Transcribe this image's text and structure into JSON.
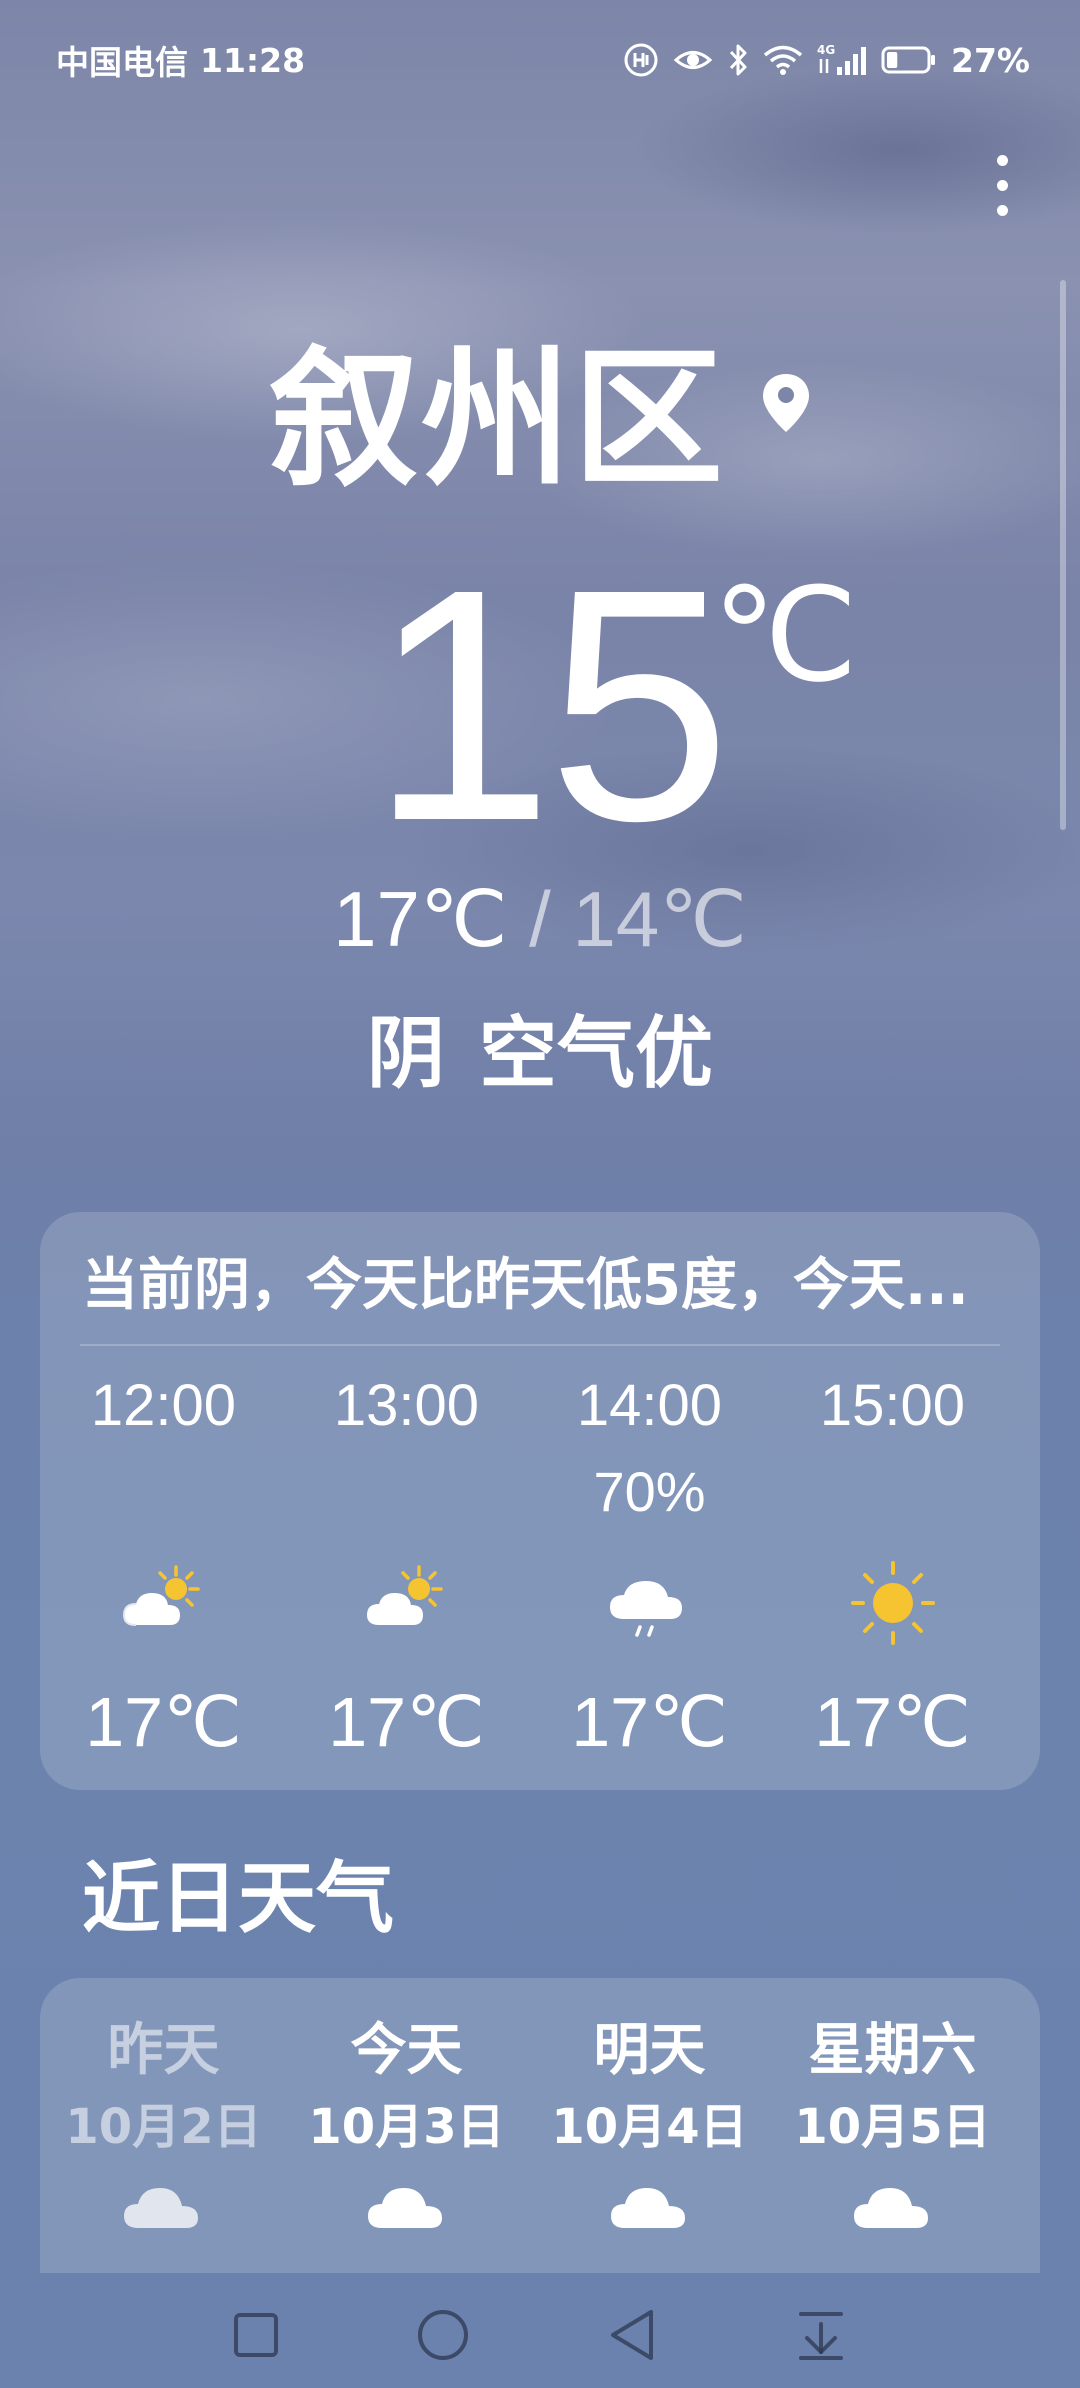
{
  "status_bar": {
    "carrier": "中国电信",
    "time": "11:28",
    "network": "4G",
    "battery_percent": "27%",
    "battery_level": 0.27,
    "icons": [
      "hd-icon",
      "eye-icon",
      "bluetooth-icon",
      "wifi-icon",
      "signal-icon",
      "battery-icon"
    ]
  },
  "location": {
    "name": "叙州区",
    "icon": "location-pin-icon"
  },
  "current": {
    "temp": "15",
    "unit": "℃",
    "high": "17℃",
    "separator": "/",
    "low": "14℃",
    "condition": "阴",
    "air_quality": "空气优"
  },
  "hourly": {
    "summary": "当前阴，今天比昨天低5度，今天...",
    "items": [
      {
        "time": "12:00",
        "precip": "",
        "icon": "partly-sunny-icon",
        "temp": "17℃"
      },
      {
        "time": "13:00",
        "precip": "",
        "icon": "partly-sunny-icon",
        "temp": "17℃"
      },
      {
        "time": "14:00",
        "precip": "70%",
        "icon": "rain-cloud-icon",
        "temp": "17℃"
      },
      {
        "time": "15:00",
        "precip": "",
        "icon": "sunny-icon",
        "temp": "17℃"
      }
    ]
  },
  "daily": {
    "title": "近日天气",
    "items": [
      {
        "day": "昨天",
        "date": "10月2日",
        "icon": "cloudy-icon"
      },
      {
        "day": "今天",
        "date": "10月3日",
        "icon": "cloudy-icon"
      },
      {
        "day": "明天",
        "date": "10月4日",
        "icon": "cloudy-icon"
      },
      {
        "day": "星期六",
        "date": "10月5日",
        "icon": "cloudy-icon"
      }
    ]
  },
  "nav": {
    "icons": [
      "recent-apps-icon",
      "home-icon",
      "back-icon",
      "notification-pull-icon"
    ]
  },
  "colors": {
    "sun": "#f6c431",
    "cloud": "#ffffff"
  }
}
